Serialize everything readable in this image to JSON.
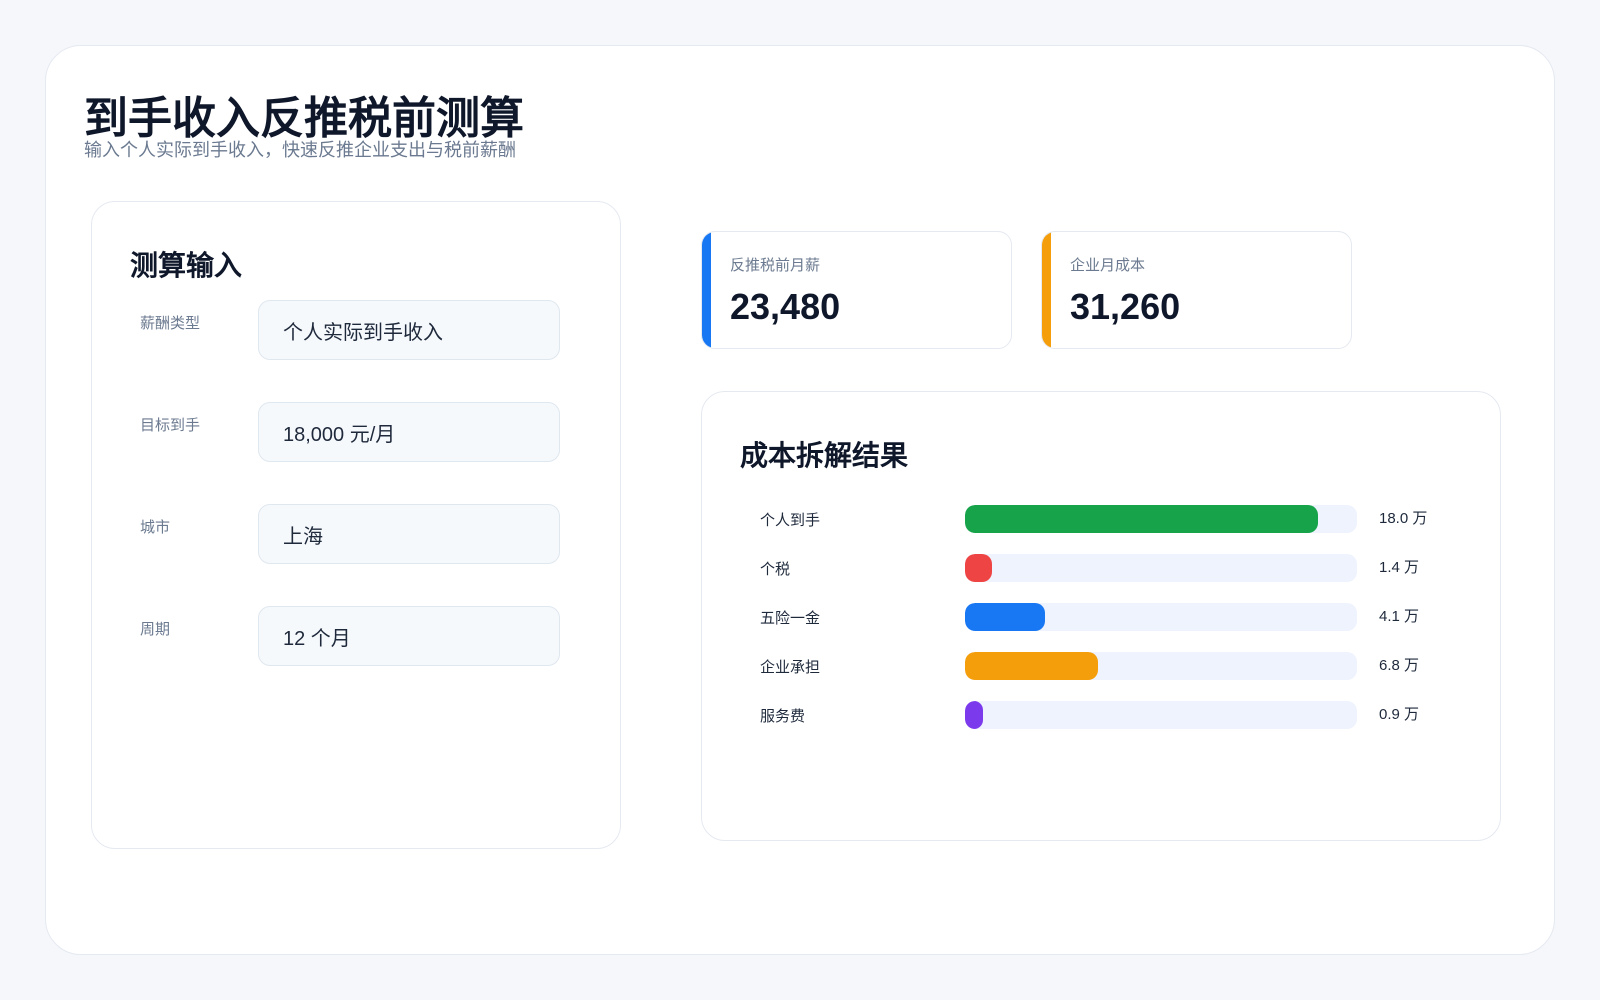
{
  "header": {
    "title": "到手收入反推税前测算",
    "subtitle": "输入个人实际到手收入，快速反推企业支出与税前薪酬"
  },
  "input_panel": {
    "title": "测算输入",
    "fields": [
      {
        "label": "薪酬类型",
        "value": "个人实际到手收入"
      },
      {
        "label": "目标到手",
        "value": "18,000 元/月"
      },
      {
        "label": "城市",
        "value": "上海"
      },
      {
        "label": "周期",
        "value": "12 个月"
      }
    ]
  },
  "kpis": [
    {
      "label": "反推税前月薪",
      "value": "23,480",
      "accent": "#1877f2"
    },
    {
      "label": "企业月成本",
      "value": "31,260",
      "accent": "#f59e0b"
    }
  ],
  "result": {
    "title": "成本拆解结果",
    "bars": [
      {
        "label": "个人到手",
        "amount": 18.0,
        "display": "18.0 万",
        "color": "#16a34a"
      },
      {
        "label": "个税",
        "amount": 1.4,
        "display": "1.4 万",
        "color": "#ef4444"
      },
      {
        "label": "五险一金",
        "amount": 4.1,
        "display": "4.1 万",
        "color": "#1877f2"
      },
      {
        "label": "企业承担",
        "amount": 6.8,
        "display": "6.8 万",
        "color": "#f59e0b"
      },
      {
        "label": "服务费",
        "amount": 0.9,
        "display": "0.9 万",
        "color": "#7c3aed"
      }
    ],
    "scale_max": 20.0
  }
}
